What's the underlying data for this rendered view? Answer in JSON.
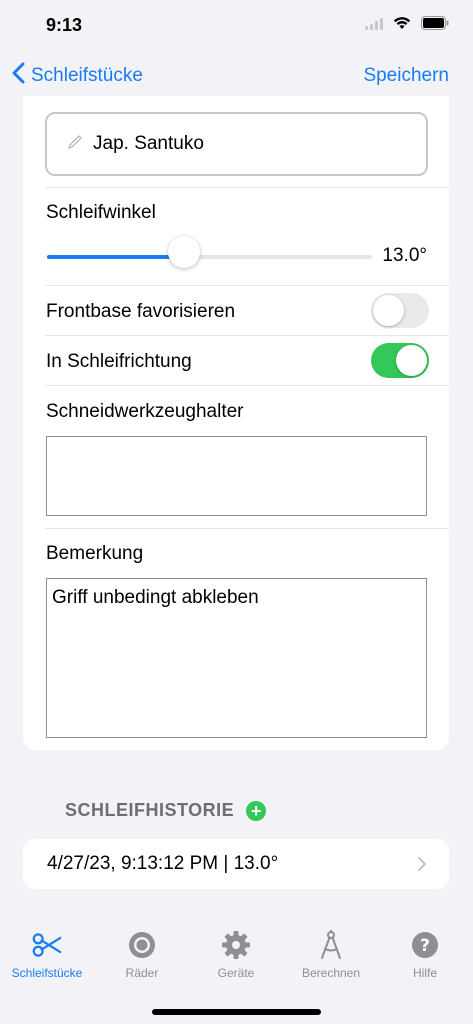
{
  "status": {
    "time": "9:13"
  },
  "nav": {
    "back_label": "Schleifstücke",
    "save_label": "Speichern"
  },
  "form": {
    "name_value": "Jap. Santuko",
    "angle_label": "Schleifwinkel",
    "angle_value": 13.0,
    "angle_value_text": "13.0°",
    "angle_fraction": 0.42,
    "frontbase_label": "Frontbase favorisieren",
    "frontbase_on": false,
    "direction_label": "In Schleifrichtung",
    "direction_on": true,
    "holder_label": "Schneidwerkzeughalter",
    "holder_value": "",
    "note_label": "Bemerkung",
    "note_value": "Griff unbedingt abkleben"
  },
  "history": {
    "title": "SCHLEIFHISTORIE",
    "add_symbol": "+",
    "entries": [
      {
        "text": "4/27/23, 9:13:12 PM | 13.0°"
      }
    ]
  },
  "tabs": [
    {
      "label": "Schleifstücke",
      "icon": "scissors-icon",
      "active": true
    },
    {
      "label": "Räder",
      "icon": "wheel-icon",
      "active": false
    },
    {
      "label": "Geräte",
      "icon": "gear-icon",
      "active": false
    },
    {
      "label": "Berechnen",
      "icon": "compass-icon",
      "active": false
    },
    {
      "label": "Hilfe",
      "icon": "help-icon",
      "active": false
    }
  ],
  "colors": {
    "accent": "#1a7cf2",
    "toggle_on": "#34c759",
    "background": "#f2f2f7"
  }
}
